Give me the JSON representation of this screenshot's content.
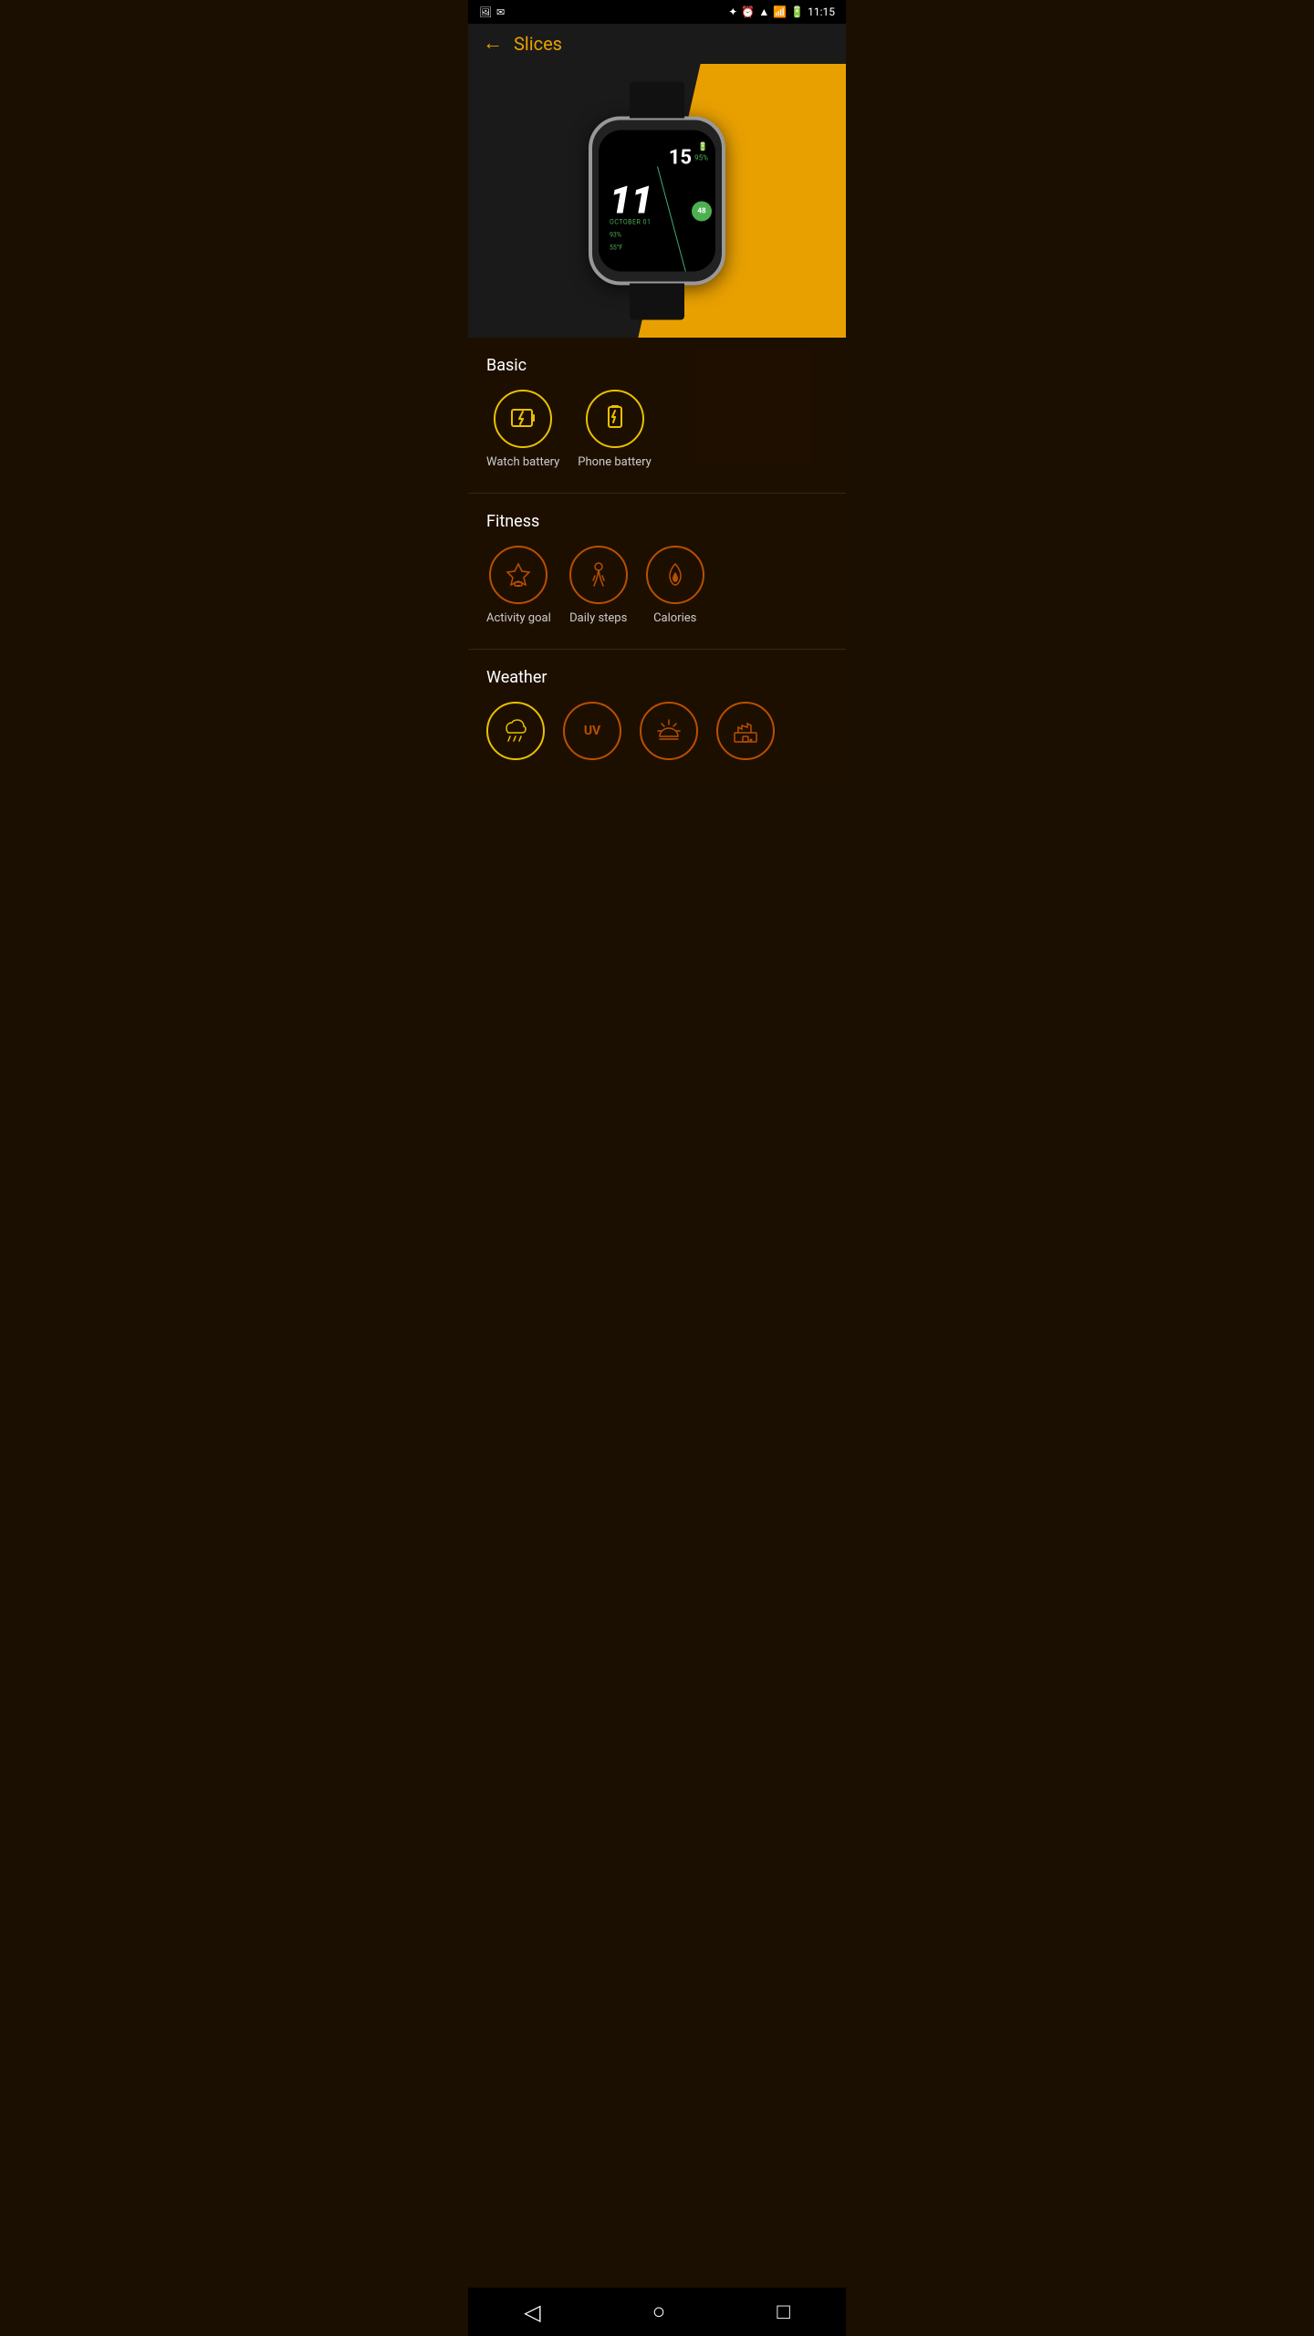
{
  "statusBar": {
    "time": "11:15",
    "icons": [
      "bluetooth",
      "alarm",
      "wifi",
      "signal",
      "battery"
    ]
  },
  "header": {
    "backLabel": "←",
    "title": "Slices"
  },
  "watch": {
    "hour": "11",
    "minute": "15",
    "batteryIcon": "🔋",
    "batteryPercent": "95%",
    "date": "OCTOBER 01",
    "phonePercent": "93%",
    "temperature": "55°F",
    "badge": "48"
  },
  "sections": {
    "basic": {
      "title": "Basic",
      "items": [
        {
          "id": "watch-battery",
          "label": "Watch battery",
          "icon": "🔋",
          "style": "yellow"
        },
        {
          "id": "phone-battery",
          "label": "Phone battery",
          "icon": "🔋",
          "style": "yellow"
        }
      ]
    },
    "fitness": {
      "title": "Fitness",
      "items": [
        {
          "id": "activity-goal",
          "label": "Activity goal",
          "icon": "🏆",
          "style": "orange"
        },
        {
          "id": "daily-steps",
          "label": "Daily steps",
          "icon": "🚶",
          "style": "orange"
        },
        {
          "id": "calories",
          "label": "Calories",
          "icon": "🔥",
          "style": "orange"
        }
      ]
    },
    "weather": {
      "title": "Weather",
      "items": [
        {
          "id": "rain",
          "label": "",
          "icon": "🌧",
          "style": "yellow"
        },
        {
          "id": "uv",
          "label": "",
          "icon": "UV",
          "style": "orange"
        },
        {
          "id": "sunrise",
          "label": "",
          "icon": "🌅",
          "style": "orange"
        },
        {
          "id": "pollution",
          "label": "",
          "icon": "🏭",
          "style": "orange"
        }
      ]
    }
  },
  "navBar": {
    "back": "◁",
    "home": "○",
    "recents": "□"
  }
}
